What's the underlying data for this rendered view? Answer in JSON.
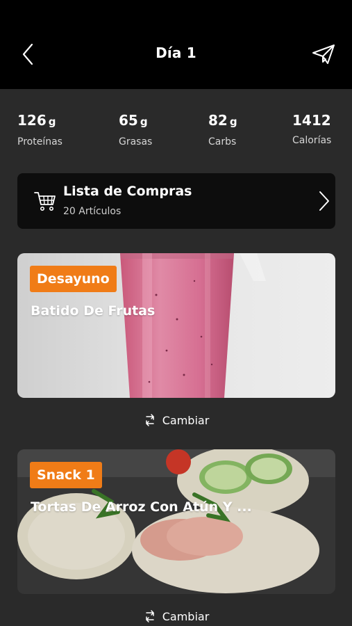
{
  "header": {
    "title": "Día 1",
    "background": "#000000"
  },
  "macros": [
    {
      "value": "126",
      "unit": "g",
      "label": "Proteínas"
    },
    {
      "value": "65",
      "unit": "g",
      "label": "Grasas"
    },
    {
      "value": "82",
      "unit": "g",
      "label": "Carbs"
    },
    {
      "value": "1412",
      "unit": "",
      "label": "Calorías"
    }
  ],
  "shopping_list": {
    "title": "Lista de Compras",
    "subtitle": "20 Artículos",
    "icon": "shopping-cart-icon"
  },
  "meals": [
    {
      "badge": "Desayuno",
      "name": "Batido De Frutas",
      "change_label": "Cambiar"
    },
    {
      "badge": "Snack 1",
      "name": "Tortas De Arroz Con Atún Y ...",
      "change_label": "Cambiar"
    }
  ],
  "colors": {
    "accent": "#f07c17",
    "background": "#2a2a2a",
    "card": "#0d0d0d"
  }
}
